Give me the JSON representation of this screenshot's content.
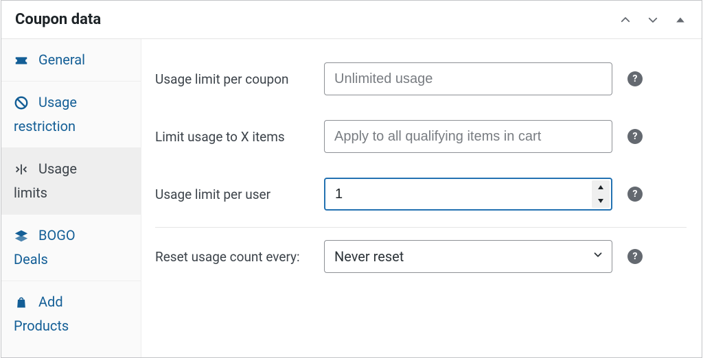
{
  "panel": {
    "title": "Coupon data"
  },
  "sidebar": {
    "items": [
      {
        "label1": "General",
        "label2": ""
      },
      {
        "label1": "Usage",
        "label2": "restriction"
      },
      {
        "label1": "Usage",
        "label2": "limits"
      },
      {
        "label1": "BOGO",
        "label2": "Deals"
      },
      {
        "label1": "Add",
        "label2": "Products"
      }
    ]
  },
  "fields": {
    "usage_limit_per_coupon": {
      "label": "Usage limit per coupon",
      "placeholder": "Unlimited usage",
      "value": ""
    },
    "limit_usage_to_x_items": {
      "label": "Limit usage to X items",
      "placeholder": "Apply to all qualifying items in cart",
      "value": ""
    },
    "usage_limit_per_user": {
      "label": "Usage limit per user",
      "value": "1"
    },
    "reset_usage_count": {
      "label": "Reset usage count every:",
      "selected": "Never reset"
    }
  },
  "help_glyph": "?"
}
